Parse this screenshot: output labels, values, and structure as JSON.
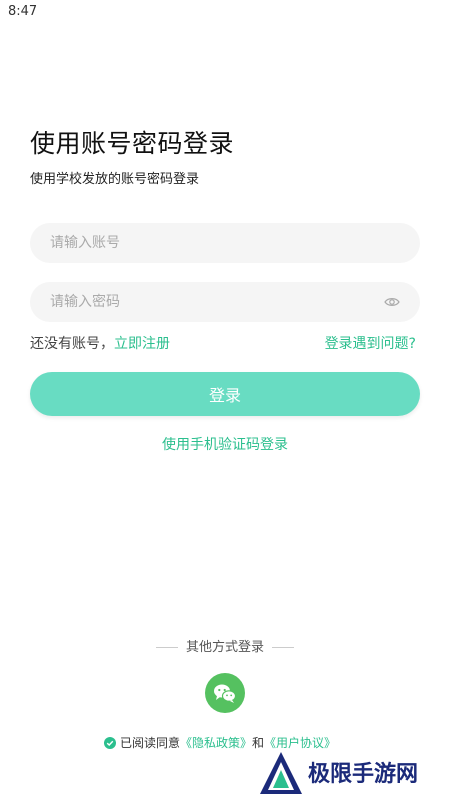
{
  "status_bar": {
    "time": "8:47"
  },
  "header": {
    "title": "使用账号密码登录",
    "subtitle": "使用学校发放的账号密码登录"
  },
  "form": {
    "account_placeholder": "请输入账号",
    "password_placeholder": "请输入密码",
    "account_value": "",
    "password_value": "",
    "no_account_text": "还没有账号，",
    "register_label": "立即注册",
    "problem_label": "登录遇到问题?",
    "login_label": "登录",
    "sms_login_label": "使用手机验证码登录"
  },
  "other_login": {
    "label": "其他方式登录",
    "wechat_icon": "wechat-icon"
  },
  "agreement": {
    "prefix": "已阅读同意",
    "privacy_label": "《隐私政策》",
    "and": "和",
    "user_label": "《用户协议》",
    "checked": true
  },
  "watermark": {
    "text": "极限手游网"
  },
  "colors": {
    "accent": "#2bbf8e",
    "button": "#68dcc2",
    "wechat": "#55c160",
    "field_bg": "#f5f5f5"
  }
}
